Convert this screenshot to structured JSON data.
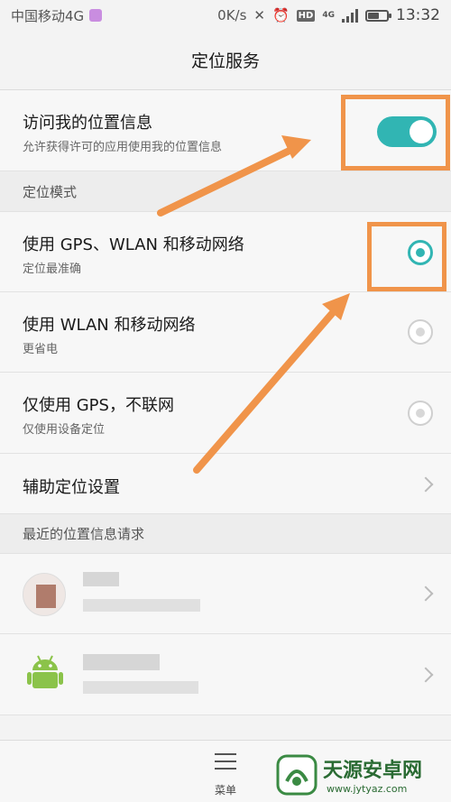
{
  "status_bar": {
    "carrier": "中国移动4G",
    "speed": "0K/s",
    "hd_badge": "HD",
    "network_badge": "4G",
    "time": "13:32",
    "battery_level": 0.6
  },
  "header": {
    "title": "定位服务"
  },
  "access_location": {
    "title": "访问我的位置信息",
    "subtitle": "允许获得许可的应用使用我的位置信息",
    "enabled": true
  },
  "mode_section": {
    "label": "定位模式"
  },
  "modes": [
    {
      "title": "使用 GPS、WLAN 和移动网络",
      "subtitle": "定位最准确",
      "selected": true
    },
    {
      "title": "使用 WLAN 和移动网络",
      "subtitle": "更省电",
      "selected": false
    },
    {
      "title": "仅使用 GPS，不联网",
      "subtitle": "仅使用设备定位",
      "selected": false
    }
  ],
  "assist_settings": {
    "title": "辅助定位设置"
  },
  "recent_section": {
    "label": "最近的位置信息请求"
  },
  "bottom_bar": {
    "menu_label": "菜单"
  },
  "watermark": {
    "brand": "天源安卓网",
    "url": "www.jytyaz.com"
  },
  "colors": {
    "accent": "#31b5b3",
    "highlight": "#f0944a"
  }
}
